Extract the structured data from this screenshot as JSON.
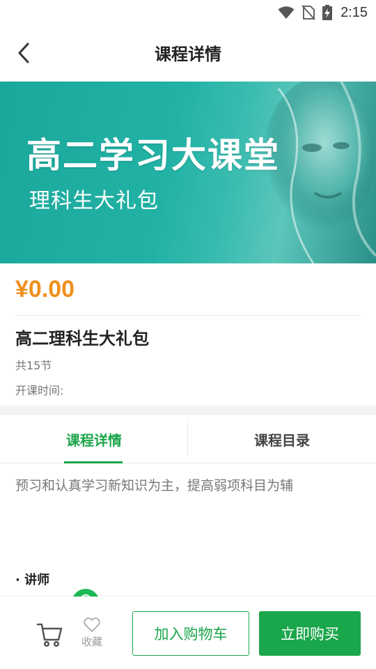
{
  "status_bar": {
    "time": "2:15"
  },
  "header": {
    "title": "课程详情"
  },
  "banner": {
    "title": "高二学习大课堂",
    "subtitle": "理科生大礼包"
  },
  "course": {
    "price": "¥0.00",
    "name": "高二理科生大礼包",
    "lesson_count": "共15节",
    "start_time_label": "开课时间:"
  },
  "tabs": [
    {
      "label": "课程详情",
      "active": true
    },
    {
      "label": "课程目录",
      "active": false
    }
  ],
  "detail": {
    "description": "预习和认真学习新知识为主，提高弱项科目为辅",
    "teacher_heading": "· 讲师"
  },
  "bottom_bar": {
    "favorite_label": "收藏",
    "add_to_cart_label": "加入购物车",
    "buy_now_label": "立即购买"
  },
  "colors": {
    "accent": "#1aa64a",
    "price": "#f0901e",
    "banner": "#22b2a5"
  }
}
